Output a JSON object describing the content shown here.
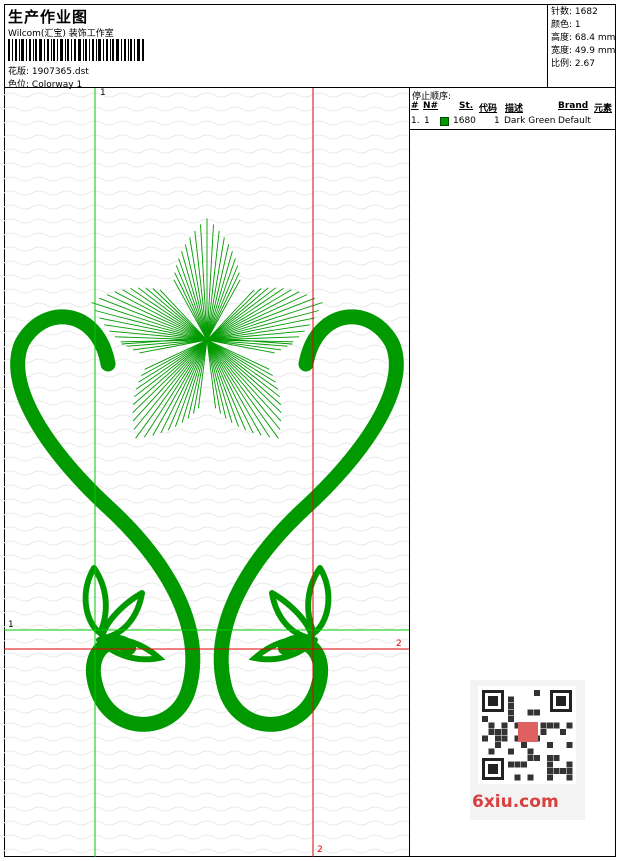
{
  "header": {
    "title": "生产作业图",
    "studio": "Wilcom(汇宝) 装饰工作室",
    "design_label": "花版:",
    "design_no": "1907365.dst",
    "colorway_label": "色位:",
    "colorway": "Colorway 1"
  },
  "stats": {
    "stitches_label": "针数:",
    "stitches": "1682",
    "colors_label": "颜色:",
    "colors": "1",
    "height_label": "高度:",
    "height": "68.4 mm",
    "width_label": "宽度:",
    "width": "49.9 mm",
    "ratio_label": "比例:",
    "ratio": "2.67"
  },
  "stop_sequence": {
    "label": "停止顺序:",
    "columns": {
      "index": "#",
      "needle": "N#",
      "stitches": "St.",
      "code": "代码",
      "description": "描述",
      "brand": "Brand",
      "element": "元素"
    },
    "rows": [
      {
        "index": "1.",
        "needle": "1",
        "swatch_color": "#009a00",
        "stitches": "1680",
        "code": "1",
        "description": "Dark Green",
        "brand": "Default"
      }
    ]
  },
  "markers": {
    "green_top": "1",
    "green_left": "1",
    "red_right": "2",
    "red_bottom": "2"
  },
  "watermark": {
    "site": "6xiu.com"
  },
  "colors": {
    "thread": "#009a00",
    "guide_green": "#00c800",
    "guide_red": "#e00000"
  }
}
